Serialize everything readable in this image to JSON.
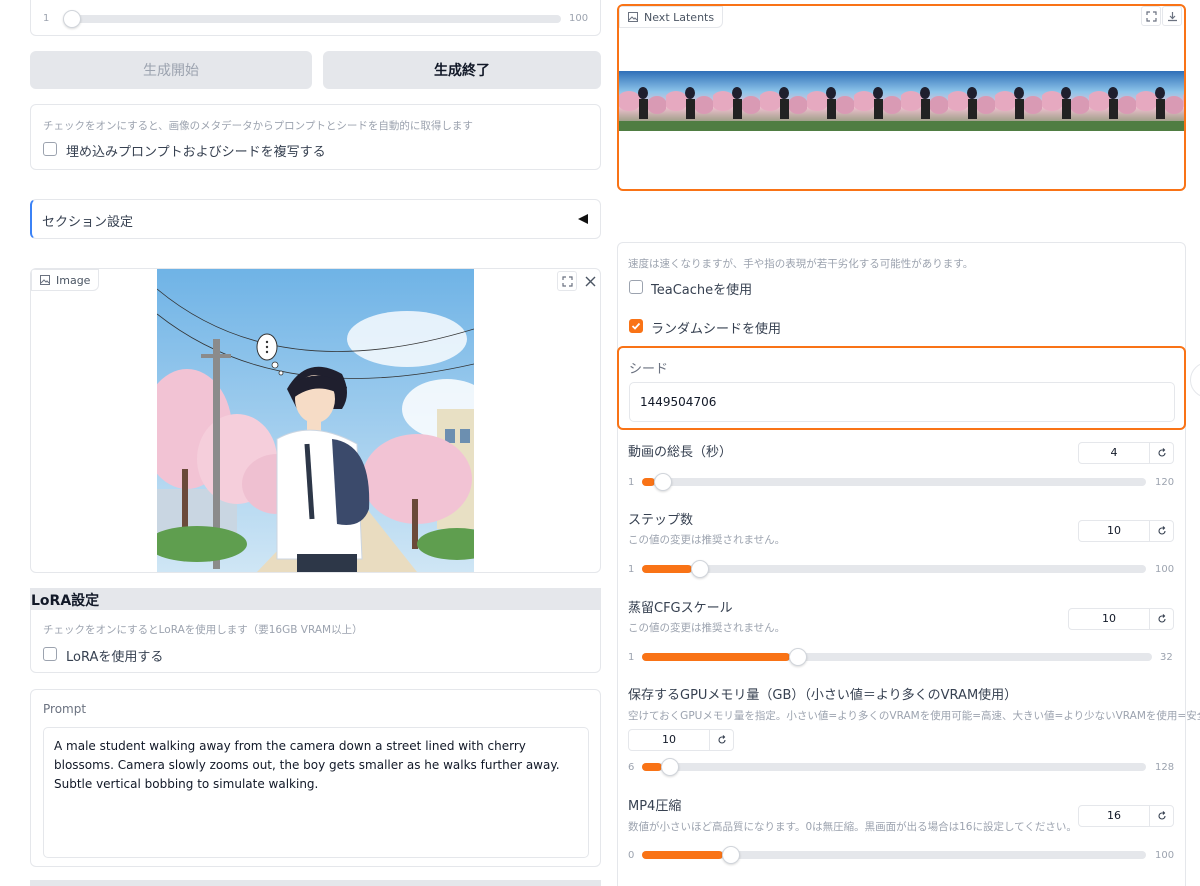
{
  "left": {
    "top_slider": {
      "min": "1",
      "max": "100",
      "fraction": 0.0
    },
    "start_button": "生成開始",
    "end_button": "生成終了",
    "metadata_note": "チェックをオンにすると、画像のメタデータからプロンプトとシードを自動的に取得します",
    "metadata_checkbox": "埋め込みプロンプトおよびシードを複写する",
    "section_settings": "セクション設定",
    "image_tag": "Image",
    "lora_header": "LoRA設定",
    "lora_note": "チェックをオンにするとLoRAを使用します（要16GB VRAM以上）",
    "lora_checkbox": "LoRAを使用する",
    "prompt_label": "Prompt",
    "prompt_text": "A male student walking away from the camera down a street lined with cherry blossoms. Camera slowly zooms out, the boy gets smaller as he walks further away. Subtle vertical bobbing to simulate walking."
  },
  "right": {
    "next_latents_tag": "Next Latents",
    "teacache_note": "速度は速くなりますが、手や指の表現が若干劣化する可能性があります。",
    "teacache_label": "TeaCacheを使用",
    "random_seed_label": "ランダムシードを使用",
    "seed_label": "シード",
    "seed_value": "1449504706",
    "duration": {
      "label": "動画の総長（秒）",
      "value": "4",
      "min": "1",
      "max": "120",
      "fraction": 0.026
    },
    "steps": {
      "label": "ステップ数",
      "note": "この値の変更は推奨されません。",
      "value": "10",
      "min": "1",
      "max": "100",
      "fraction": 0.1
    },
    "cfg": {
      "label": "蒸留CFGスケール",
      "note": "この値の変更は推奨されません。",
      "value": "10",
      "min": "1",
      "max": "32",
      "fraction": 0.29
    },
    "gpu_mem": {
      "label": "保存するGPUメモリ量（GB）（小さい値＝より多くのVRAM使用）",
      "note": "空けておくGPUメモリ量を指定。小さい値=より多くのVRAMを使用可能=高速、大きい値=より少ないVRAMを使用=安全",
      "value": "10",
      "min": "6",
      "max": "128",
      "fraction": 0.04
    },
    "mp4": {
      "label": "MP4圧縮",
      "note": "数値が小さいほど高品質になります。0は無圧縮。黒画面が出る場合は16に設定してください。",
      "value": "16",
      "min": "0",
      "max": "100",
      "fraction": 0.16
    }
  },
  "colors": {
    "accent": "#f97316",
    "border": "#e5e7eb",
    "muted": "#9ca3af"
  },
  "icons": [
    "image-icon",
    "fullscreen-icon",
    "close-icon",
    "download-icon",
    "reset-icon",
    "collapse-arrow-icon",
    "check-icon"
  ]
}
